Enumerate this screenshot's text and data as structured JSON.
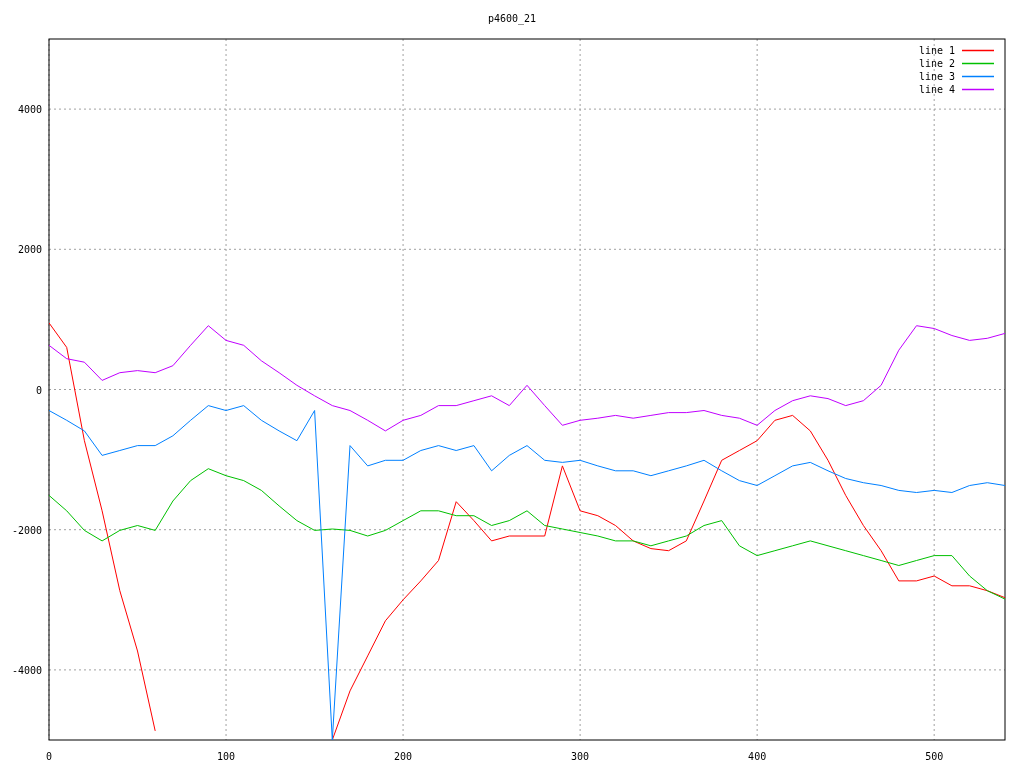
{
  "chart_data": {
    "type": "line",
    "title": "p4600_21",
    "x": [
      0,
      10,
      20,
      30,
      40,
      50,
      60,
      70,
      80,
      90,
      100,
      110,
      120,
      130,
      140,
      150,
      160,
      170,
      180,
      190,
      200,
      210,
      220,
      230,
      240,
      250,
      260,
      270,
      280,
      290,
      300,
      310,
      320,
      330,
      340,
      350,
      360,
      370,
      380,
      390,
      400,
      410,
      420,
      430,
      440,
      450,
      460,
      470,
      480,
      490,
      500,
      510,
      520,
      530,
      540
    ],
    "series": [
      {
        "name": "line 1",
        "color": "#ff0000",
        "values": [
          950,
          600,
          -730,
          -1730,
          -2870,
          -3730,
          -4870,
          null,
          null,
          null,
          null,
          null,
          null,
          null,
          null,
          null,
          -5000,
          -4300,
          -3800,
          -3300,
          -3000,
          -2730,
          -2440,
          -1600,
          -1870,
          -2160,
          -2090,
          -2090,
          -2090,
          -1090,
          -1730,
          -1800,
          -1940,
          -2160,
          -2270,
          -2300,
          -2160,
          -1590,
          -1010,
          -870,
          -730,
          -440,
          -370,
          -590,
          -1010,
          -1510,
          -1940,
          -2300,
          -2730,
          -2730,
          -2660,
          -2800,
          -2800,
          -2870,
          -2970
        ]
      },
      {
        "name": "line 2",
        "color": "#00c000",
        "values": [
          -1510,
          -1730,
          -2010,
          -2160,
          -2010,
          -1940,
          -2010,
          -1590,
          -1300,
          -1130,
          -1230,
          -1300,
          -1440,
          -1660,
          -1870,
          -2010,
          -1990,
          -2010,
          -2090,
          -2010,
          -1870,
          -1730,
          -1730,
          -1800,
          -1800,
          -1940,
          -1870,
          -1730,
          -1940,
          -1990,
          -2040,
          -2090,
          -2160,
          -2160,
          -2230,
          -2160,
          -2090,
          -1940,
          -1870,
          -2230,
          -2370,
          -2300,
          -2230,
          -2160,
          -2230,
          -2300,
          -2370,
          -2440,
          -2510,
          -2440,
          -2370,
          -2370,
          -2660,
          -2870,
          -2990
        ]
      },
      {
        "name": "line 3",
        "color": "#0080ff",
        "values": [
          -300,
          -440,
          -590,
          -940,
          -870,
          -800,
          -800,
          -660,
          -440,
          -230,
          -300,
          -230,
          -440,
          -590,
          -730,
          -300,
          -5000,
          -800,
          -1090,
          -1010,
          -1010,
          -870,
          -800,
          -870,
          -800,
          -1160,
          -940,
          -800,
          -1010,
          -1040,
          -1010,
          -1090,
          -1160,
          -1160,
          -1230,
          -1160,
          -1090,
          -1010,
          -1160,
          -1300,
          -1370,
          -1230,
          -1090,
          -1040,
          -1160,
          -1270,
          -1330,
          -1370,
          -1440,
          -1470,
          -1440,
          -1470,
          -1370,
          -1330,
          -1370
        ]
      },
      {
        "name": "line 4",
        "color": "#c000ff",
        "values": [
          630,
          440,
          390,
          130,
          240,
          270,
          240,
          340,
          630,
          910,
          700,
          630,
          410,
          240,
          60,
          -90,
          -230,
          -300,
          -440,
          -590,
          -440,
          -370,
          -230,
          -230,
          -160,
          -90,
          -230,
          60,
          -230,
          -510,
          -440,
          -410,
          -370,
          -410,
          -370,
          -330,
          -330,
          -300,
          -370,
          -410,
          -510,
          -300,
          -160,
          -90,
          -130,
          -230,
          -160,
          60,
          560,
          910,
          870,
          770,
          700,
          730,
          800
        ]
      }
    ],
    "grid": true,
    "legend": true,
    "xlim": [
      0,
      540
    ],
    "ylim": [
      -5000,
      5000
    ],
    "xticks": [
      0,
      100,
      200,
      300,
      400,
      500
    ],
    "yticks": [
      -4000,
      -2000,
      0,
      2000,
      4000
    ]
  }
}
